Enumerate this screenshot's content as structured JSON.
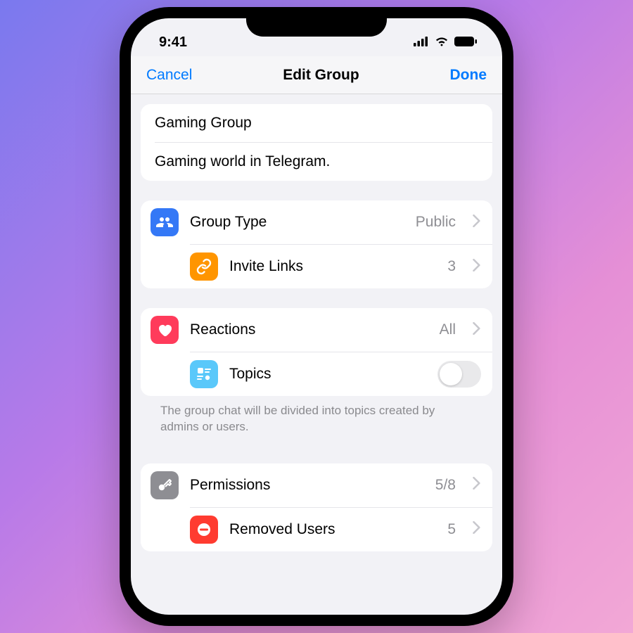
{
  "statusbar": {
    "time": "9:41"
  },
  "navbar": {
    "cancel": "Cancel",
    "title": "Edit Group",
    "done": "Done"
  },
  "group": {
    "name": "Gaming Group",
    "description": "Gaming world in Telegram."
  },
  "rows": {
    "groupType": {
      "label": "Group Type",
      "value": "Public"
    },
    "inviteLinks": {
      "label": "Invite Links",
      "value": "3"
    },
    "reactions": {
      "label": "Reactions",
      "value": "All"
    },
    "topics": {
      "label": "Topics",
      "enabled": false
    },
    "permissions": {
      "label": "Permissions",
      "value": "5/8"
    },
    "removed": {
      "label": "Removed Users",
      "value": "5"
    }
  },
  "notes": {
    "topics": "The group chat will be divided into topics created by admins or users."
  },
  "colors": {
    "groupType": "#3478f6",
    "inviteLinks": "#ff9500",
    "reactions": "#ff3b5b",
    "topics": "#5ac8fa",
    "permissions": "#8e8e93",
    "removed": "#ff3b30"
  }
}
